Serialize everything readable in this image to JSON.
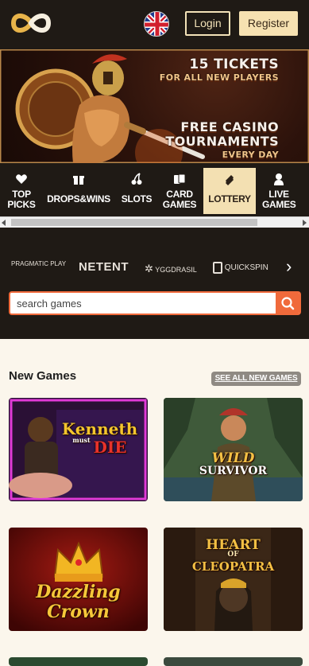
{
  "header": {
    "login_label": "Login",
    "register_label": "Register",
    "language": "English (UK)"
  },
  "banner": {
    "line1": "15 TICKETS",
    "line2": "FOR ALL NEW PLAYERS",
    "line3": "FREE CASINO",
    "line4": "TOURNAMENTS",
    "line5": "EVERY DAY"
  },
  "categories": [
    {
      "line1": "TOP",
      "line2": "PICKS",
      "icon": "heart-icon"
    },
    {
      "line1": "DROPS&WINS",
      "line2": "",
      "icon": "gift-icon"
    },
    {
      "line1": "SLOTS",
      "line2": "",
      "icon": "cherry-icon"
    },
    {
      "line1": "CARD",
      "line2": "GAMES",
      "icon": "cards-icon"
    },
    {
      "line1": "LOTTERY",
      "line2": "",
      "icon": "ticket-icon",
      "active": true
    },
    {
      "line1": "LIVE",
      "line2": "GAMES",
      "icon": "dealer-icon"
    }
  ],
  "providers": [
    "PRAGMATIC PLAY",
    "NETENT",
    "YGGDRASIL",
    "QUICKSPIN"
  ],
  "search": {
    "placeholder": "search games"
  },
  "new_games": {
    "title": "New Games",
    "see_all": "SEE ALL NEW GAMES",
    "games": [
      {
        "title_line1": "Kenneth",
        "title_mid": "must",
        "title_line2": "DIE"
      },
      {
        "title_line1": "WILD",
        "title_line2": "SURVIVOR"
      },
      {
        "title_line1": "Dazzling",
        "title_line2": "Crown"
      },
      {
        "title_line1": "HEART",
        "title_mid": "OF",
        "title_line2": "CLEOPATRA"
      }
    ]
  },
  "colors": {
    "header_bg": "#1f1a15",
    "accent_cream": "#f3e0b2",
    "search_orange": "#f06a3b",
    "page_bg": "#fbf6ec"
  }
}
